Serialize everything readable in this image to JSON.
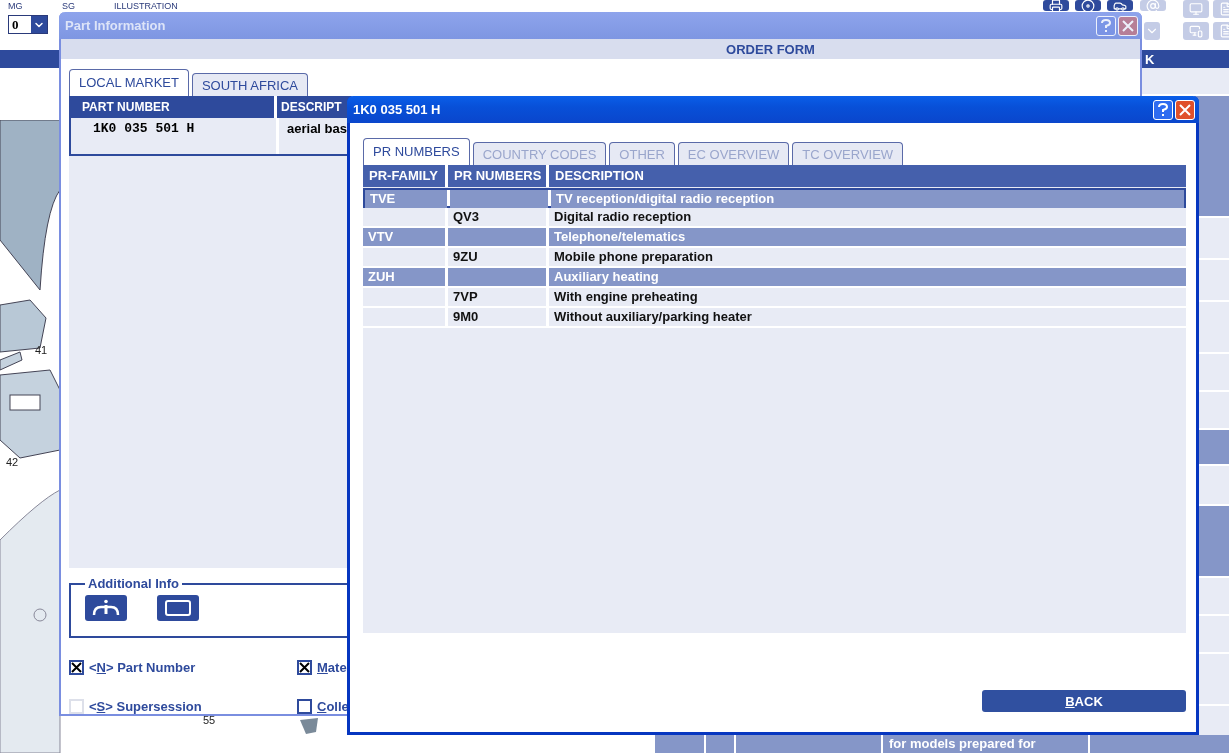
{
  "app": {
    "labels": [
      "MG",
      "SG",
      "ILLUSTRATION"
    ],
    "mg_value": "0",
    "header_fragment": "K",
    "callouts": [
      "41",
      "42",
      "55"
    ],
    "bottom_text": "for models prepared for"
  },
  "part_window": {
    "title": "Part Information",
    "section": "ORDER FORM",
    "tabs": [
      {
        "label": "LOCAL MARKET",
        "selected": true
      },
      {
        "label": "SOUTH AFRICA",
        "selected": false
      }
    ],
    "columns": [
      "PART NUMBER",
      "DESCRIPT"
    ],
    "rows": [
      {
        "part_number": "1K0 035 501 H",
        "description": "aerial bas"
      }
    ],
    "additional_info": {
      "legend": "Additional Info"
    },
    "options": [
      {
        "before": "<",
        "key": "N",
        "after": "> Part Number",
        "checked": true,
        "disabled": false
      },
      {
        "key": "M",
        "after": "ate",
        "checked": true,
        "disabled": false
      },
      {
        "before": "<",
        "key": "S",
        "after": "> Supersession",
        "checked": false,
        "disabled": true
      },
      {
        "key": "C",
        "after": "olle",
        "checked": false,
        "disabled": false
      }
    ]
  },
  "pr_window": {
    "title": "1K0 035 501 H",
    "tabs": [
      {
        "label": "PR NUMBERS",
        "selected": true,
        "disabled": false
      },
      {
        "label": "COUNTRY CODES",
        "selected": false,
        "disabled": true
      },
      {
        "label": "OTHER",
        "selected": false,
        "disabled": true
      },
      {
        "label": "EC OVERVIEW",
        "selected": false,
        "disabled": true
      },
      {
        "label": "TC OVERVIEW",
        "selected": false,
        "disabled": true
      }
    ],
    "columns": [
      "PR-FAMILY",
      "PR NUMBERS",
      "DESCRIPTION"
    ],
    "rows": [
      {
        "kind": "group",
        "family": "TVE",
        "description": "TV reception/digital radio reception",
        "selected": true
      },
      {
        "kind": "item",
        "number": "QV3",
        "description": "Digital radio reception",
        "selected": false
      },
      {
        "kind": "group",
        "family": "VTV",
        "description": "Telephone/telematics",
        "selected": false
      },
      {
        "kind": "item",
        "number": "9ZU",
        "description": "Mobile phone preparation",
        "selected": false
      },
      {
        "kind": "group",
        "family": "ZUH",
        "description": "Auxiliary heating",
        "selected": false
      },
      {
        "kind": "item",
        "number": "7VP",
        "description": "With engine preheating",
        "selected": false
      },
      {
        "kind": "item",
        "number": "9M0",
        "description": "Without auxiliary/parking heater",
        "selected": false
      }
    ],
    "back_button": {
      "key": "B",
      "rest": "ACK"
    }
  }
}
